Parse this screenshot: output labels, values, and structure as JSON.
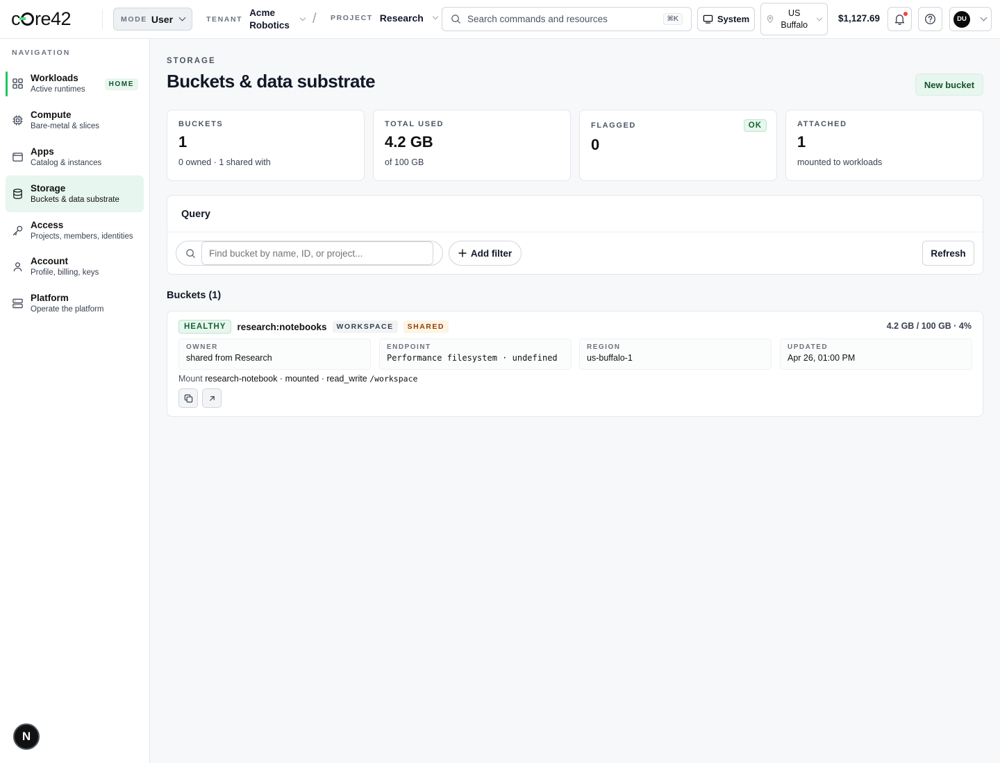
{
  "header": {
    "logo": "core42",
    "mode": {
      "label": "MODE",
      "value": "User"
    },
    "tenant": {
      "label": "TENANT",
      "value": "Acme Robotics"
    },
    "separator": "/",
    "project": {
      "label": "PROJECT",
      "value": "Research"
    },
    "search": {
      "placeholder": "Search commands and resources",
      "shortcut": "⌘K"
    },
    "system_label": "System",
    "region": "US Buffalo",
    "balance": "$1,127.69",
    "user_initials": "DU"
  },
  "sidebar": {
    "title": "NAVIGATION",
    "items": [
      {
        "title": "Workloads",
        "subtitle": "Active runtimes",
        "badge": "HOME",
        "icon": "grid-icon"
      },
      {
        "title": "Compute",
        "subtitle": "Bare-metal & slices",
        "icon": "cpu-icon"
      },
      {
        "title": "Apps",
        "subtitle": "Catalog & instances",
        "icon": "window-icon"
      },
      {
        "title": "Storage",
        "subtitle": "Buckets & data substrate",
        "icon": "database-icon",
        "active": true
      },
      {
        "title": "Access",
        "subtitle": "Projects, members, identities",
        "icon": "key-icon"
      },
      {
        "title": "Account",
        "subtitle": "Profile, billing, keys",
        "icon": "user-icon"
      },
      {
        "title": "Platform",
        "subtitle": "Operate the platform",
        "icon": "server-icon"
      }
    ],
    "fab_label": "N"
  },
  "page": {
    "breadcrumb": "STORAGE",
    "title": "Buckets & data substrate",
    "new_button": "New bucket"
  },
  "stats": [
    {
      "label": "BUCKETS",
      "value": "1",
      "sub": "0 owned · 1 shared with"
    },
    {
      "label": "TOTAL USED",
      "value": "4.2 GB",
      "sub": "of 100 GB"
    },
    {
      "label": "FLAGGED",
      "value": "0",
      "badge": "OK"
    },
    {
      "label": "ATTACHED",
      "value": "1",
      "sub": "mounted to workloads"
    }
  ],
  "query": {
    "title": "Query",
    "placeholder": "Find bucket by name, ID, or project...",
    "add_filter": "Add filter",
    "refresh": "Refresh"
  },
  "buckets": {
    "heading": "Buckets (1)",
    "items": [
      {
        "status": "HEALTHY",
        "name": "research:notebooks",
        "kind": "WORKSPACE",
        "share": "SHARED",
        "usage": "4.2 GB / 100 GB · 4%",
        "fields": [
          {
            "label": "OWNER",
            "value": "shared from Research"
          },
          {
            "label": "ENDPOINT",
            "value": "Performance filesystem · undefined"
          },
          {
            "label": "REGION",
            "value": "us-buffalo-1"
          },
          {
            "label": "UPDATED",
            "value": "Apr 26, 01:00 PM"
          }
        ],
        "mount_label": "Mount",
        "mount_value": "research-notebook · mounted · read_write",
        "mount_path": "/workspace"
      }
    ]
  },
  "colors": {
    "accent": "#22c55e",
    "accent_bg": "#e7f6ee",
    "text": "#111827"
  }
}
